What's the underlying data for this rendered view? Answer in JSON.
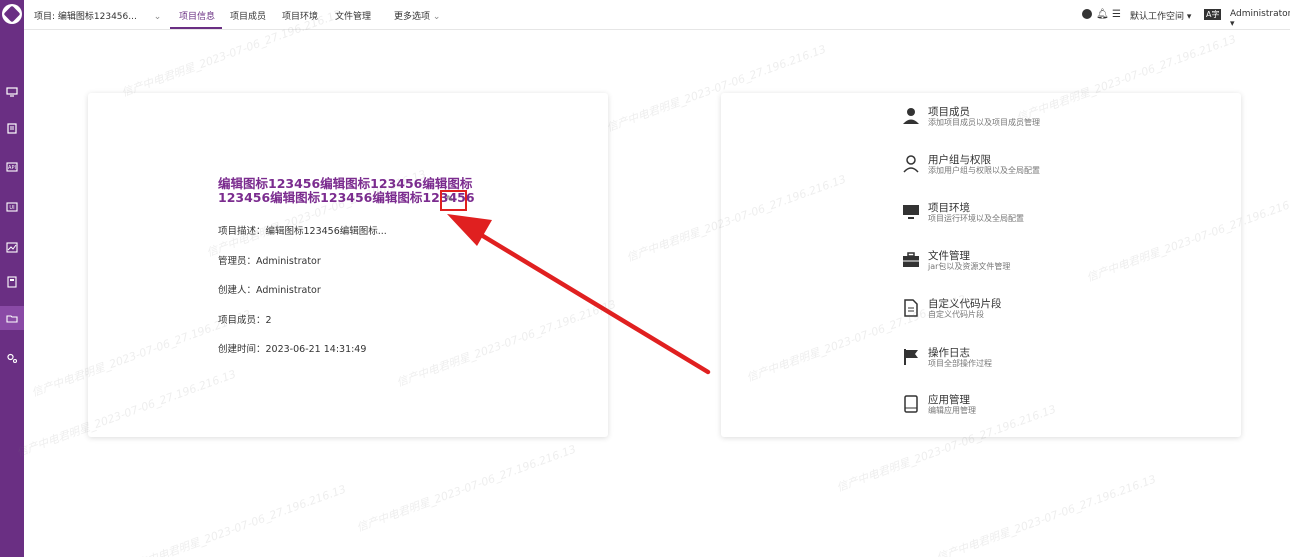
{
  "topbar": {
    "project_selector": "项目: 编辑图标123456...",
    "tabs": [
      "项目信息",
      "项目成员",
      "项目环境",
      "文件管理",
      "更多选项"
    ],
    "workspace": "默认工作空间",
    "user": "Administrator"
  },
  "project": {
    "title": "编辑图标123456编辑图标123456编辑图标123456编辑图标123456编辑图标123456",
    "description": "项目描述：编辑图标123456编辑图标...",
    "manager": "管理员：Administrator",
    "creator": "创建人：Administrator",
    "members": "项目成员：2",
    "created_time": "创建时间：2023-06-21 14:31:49"
  },
  "menu": [
    {
      "title": "项目成员",
      "desc": "添加项目成员以及项目成员管理",
      "icon": "person-icon"
    },
    {
      "title": "用户组与权限",
      "desc": "添加用户组与权限以及全局配置",
      "icon": "person-outline-icon"
    },
    {
      "title": "项目环境",
      "desc": "项目运行环境以及全局配置",
      "icon": "monitor-icon"
    },
    {
      "title": "文件管理",
      "desc": "jar包以及资源文件管理",
      "icon": "briefcase-icon"
    },
    {
      "title": "自定义代码片段",
      "desc": "自定义代码片段",
      "icon": "document-icon"
    },
    {
      "title": "操作日志",
      "desc": "项目全部操作过程",
      "icon": "flag-icon"
    },
    {
      "title": "应用管理",
      "desc": "编辑应用管理",
      "icon": "tablet-icon"
    }
  ],
  "watermark": "信产中电君明星_2023-07-06_27.196.216.13",
  "colors": {
    "brand": "#6a2f83",
    "title": "#7b2c8f",
    "annotation": "#e02020"
  }
}
